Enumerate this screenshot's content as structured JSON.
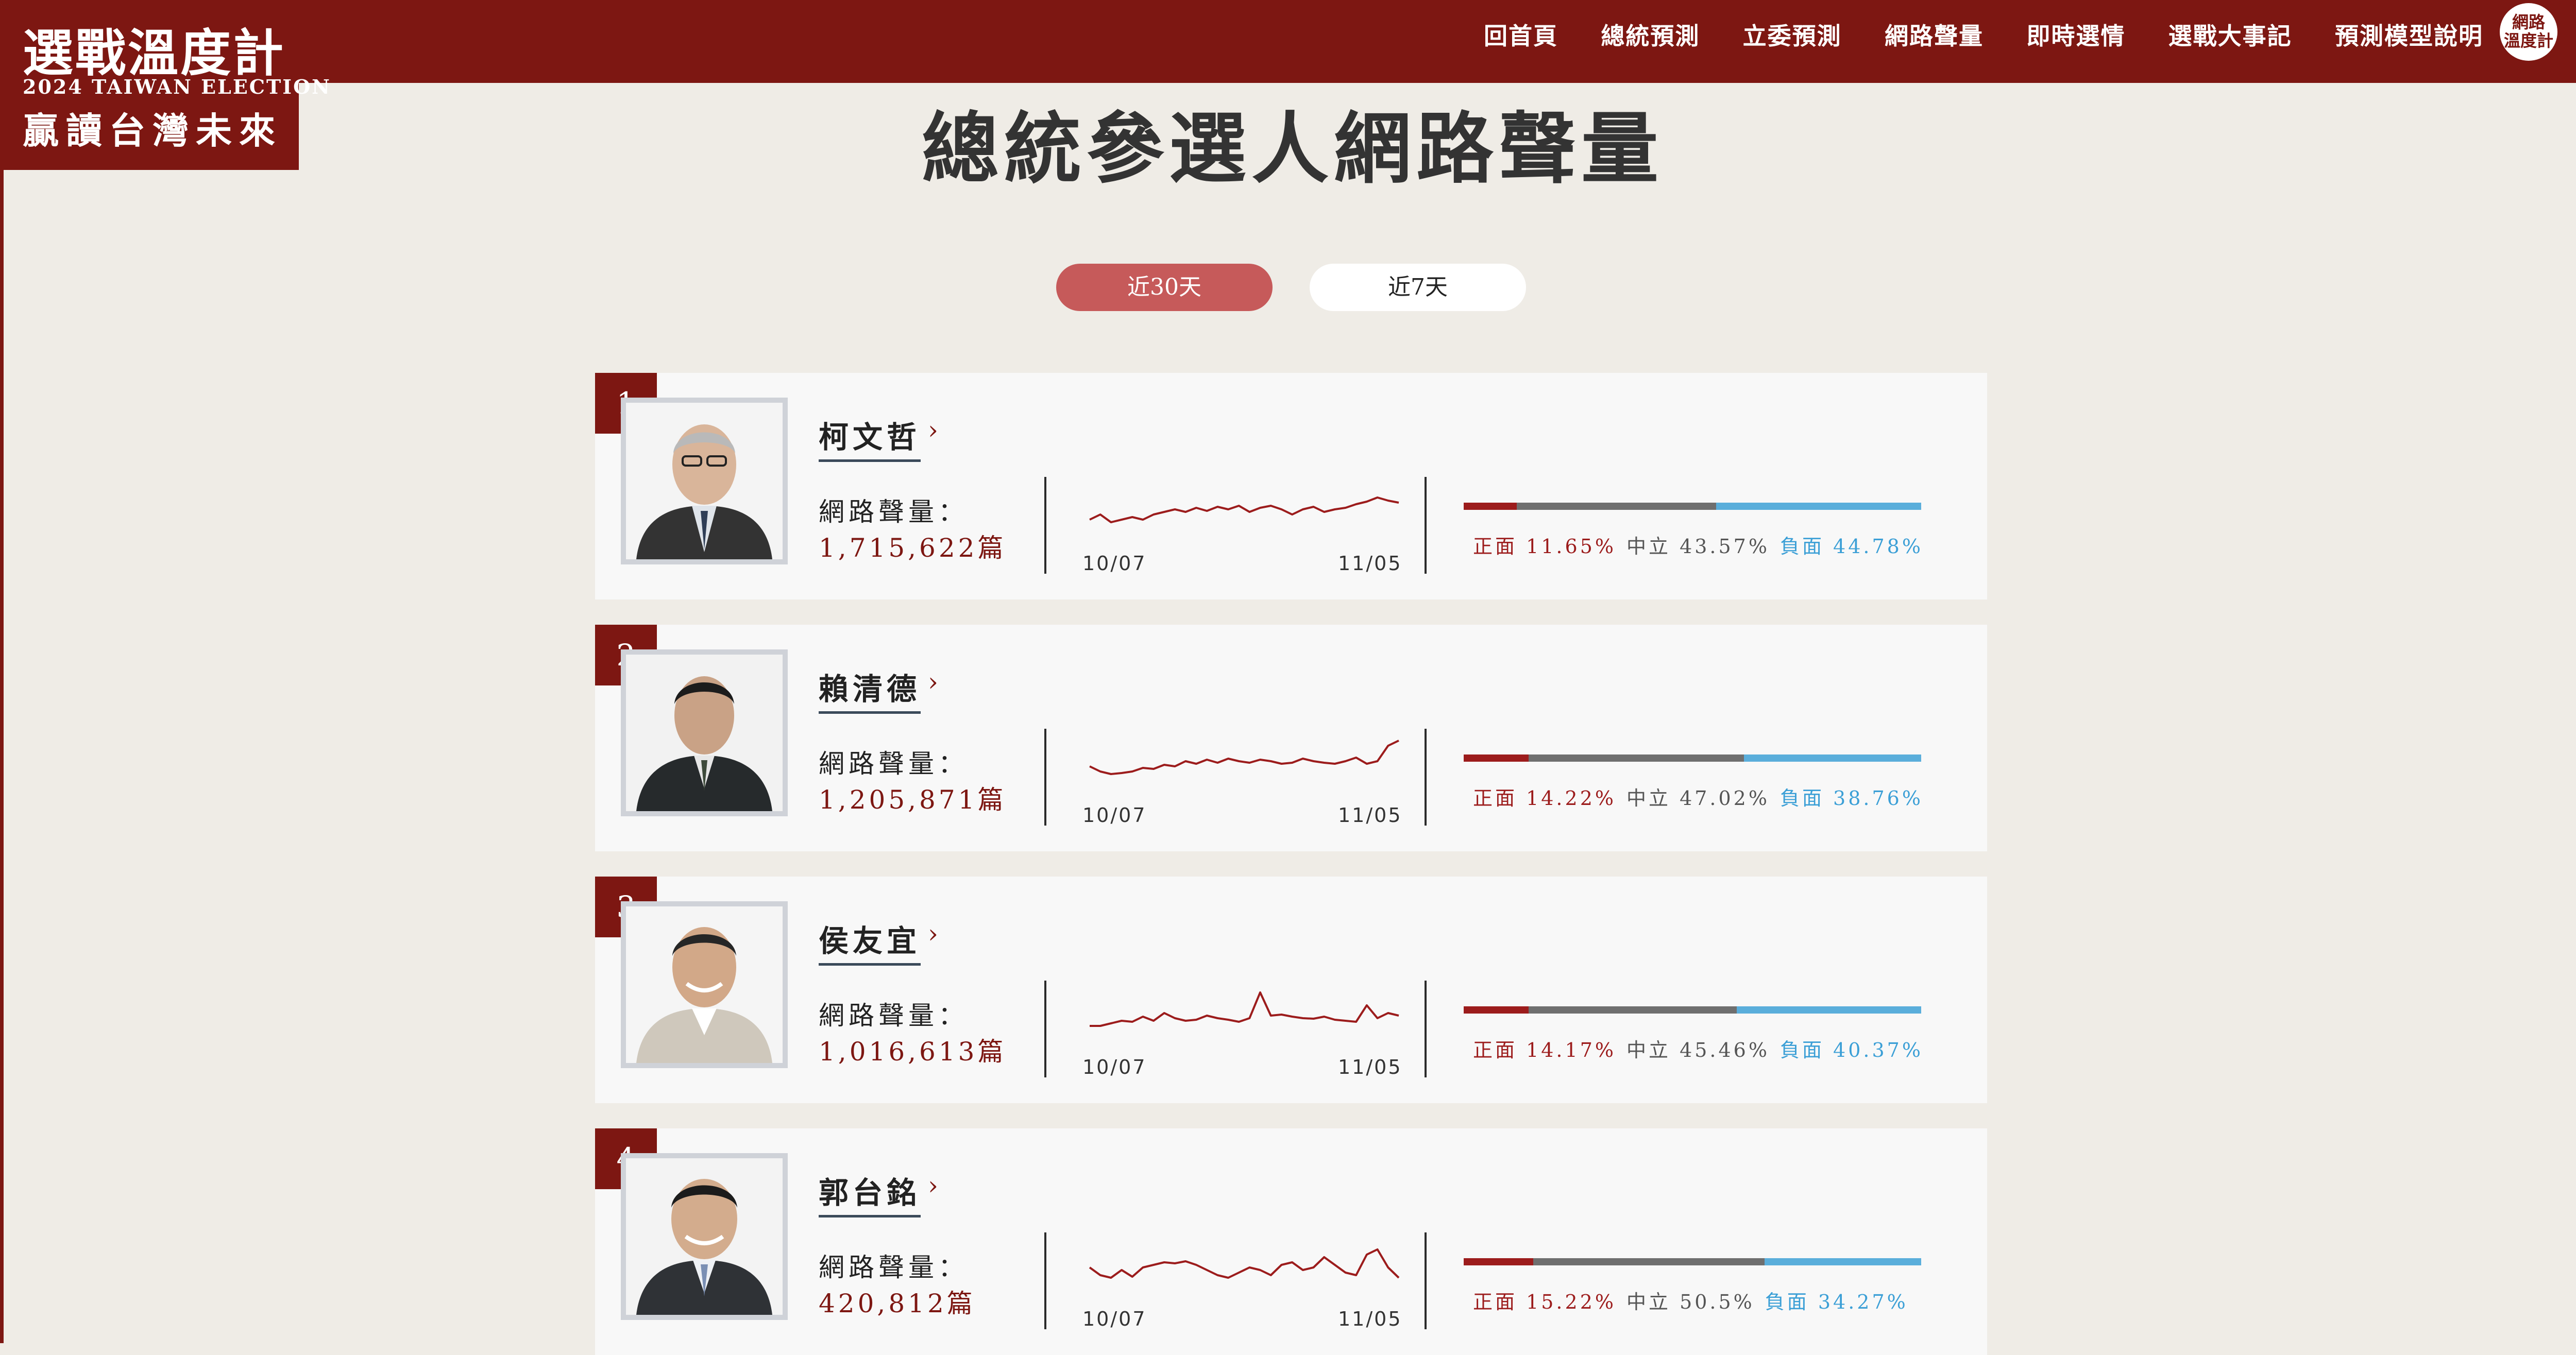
{
  "header": {
    "logo_title": "選戰溫度計",
    "logo_subtitle": "2024 TAIWAN ELECTION",
    "logo_slogan": "贏讀台灣未來",
    "nav": [
      "回首頁",
      "總統預測",
      "立委預測",
      "網路聲量",
      "即時選情",
      "選戰大事記",
      "預測模型說明"
    ],
    "badge_line1": "網路",
    "badge_line2": "溫度計"
  },
  "page_title": "總統參選人網路聲量",
  "tabs": {
    "active": "近30天",
    "inactive": "近7天"
  },
  "volume_label": "網路聲量：",
  "unit": "篇",
  "date_start": "10/07",
  "date_end": "11/05",
  "colors": {
    "brand": "#7d1712",
    "positive": "#9c1c1c",
    "neutral": "#6f6f6f",
    "negative": "#5aaedb",
    "active_tab": "#c65a5a"
  },
  "candidates": [
    {
      "rank": "1",
      "name": "柯文哲",
      "volume": "1,715,622",
      "positive": "正面 11.65%",
      "neutral": "中立 43.57%",
      "negative": "負面 44.78%",
      "pos_pct": 11.65,
      "neu_pct": 43.57,
      "neg_pct": 44.78,
      "trend": [
        0.35,
        0.45,
        0.3,
        0.35,
        0.4,
        0.35,
        0.45,
        0.5,
        0.55,
        0.5,
        0.58,
        0.52,
        0.6,
        0.55,
        0.62,
        0.5,
        0.58,
        0.62,
        0.55,
        0.45,
        0.55,
        0.6,
        0.5,
        0.55,
        0.58,
        0.65,
        0.7,
        0.78,
        0.72,
        0.68
      ]
    },
    {
      "rank": "2",
      "name": "賴清德",
      "volume": "1,205,871",
      "positive": "正面 14.22%",
      "neutral": "中立 47.02%",
      "negative": "負面 38.76%",
      "pos_pct": 14.22,
      "neu_pct": 47.02,
      "neg_pct": 38.76,
      "trend": [
        0.45,
        0.35,
        0.3,
        0.32,
        0.35,
        0.42,
        0.4,
        0.48,
        0.45,
        0.55,
        0.5,
        0.58,
        0.52,
        0.6,
        0.55,
        0.52,
        0.58,
        0.55,
        0.5,
        0.52,
        0.6,
        0.55,
        0.52,
        0.5,
        0.55,
        0.62,
        0.5,
        0.55,
        0.85,
        0.95
      ]
    },
    {
      "rank": "3",
      "name": "侯友宜",
      "volume": "1,016,613",
      "positive": "正面 14.17%",
      "neutral": "中立 45.46%",
      "negative": "負面 40.37%",
      "pos_pct": 14.17,
      "neu_pct": 45.46,
      "neg_pct": 40.37,
      "trend": [
        0.3,
        0.3,
        0.35,
        0.4,
        0.38,
        0.48,
        0.4,
        0.55,
        0.45,
        0.4,
        0.42,
        0.5,
        0.45,
        0.42,
        0.38,
        0.45,
        0.95,
        0.5,
        0.52,
        0.48,
        0.45,
        0.44,
        0.48,
        0.42,
        0.4,
        0.38,
        0.7,
        0.45,
        0.55,
        0.5
      ]
    },
    {
      "rank": "4",
      "name": "郭台銘",
      "volume": "420,812",
      "positive": "正面 15.22%",
      "neutral": "中立 50.5%",
      "negative": "負面 34.27%",
      "pos_pct": 15.22,
      "neu_pct": 50.5,
      "neg_pct": 34.27,
      "trend": [
        0.5,
        0.35,
        0.3,
        0.45,
        0.32,
        0.5,
        0.55,
        0.6,
        0.58,
        0.62,
        0.55,
        0.45,
        0.35,
        0.3,
        0.4,
        0.5,
        0.45,
        0.35,
        0.55,
        0.6,
        0.45,
        0.5,
        0.7,
        0.55,
        0.4,
        0.35,
        0.75,
        0.85,
        0.5,
        0.3
      ]
    }
  ]
}
